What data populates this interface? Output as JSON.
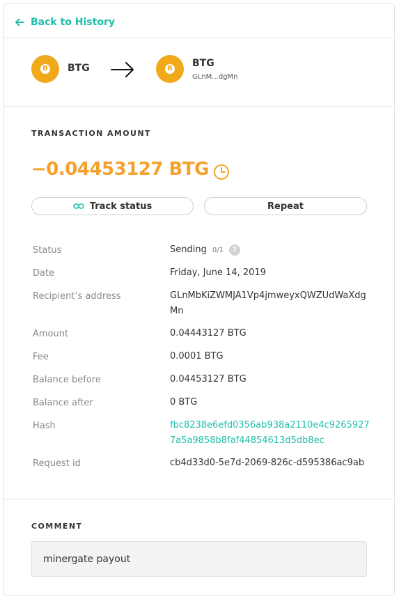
{
  "header": {
    "back_label": "Back to History"
  },
  "transfer": {
    "from": {
      "currency": "BTG",
      "icon": "btg-coin-icon"
    },
    "to": {
      "currency": "BTG",
      "address_short": "GLnM...dgMn",
      "icon": "btg-coin-icon"
    }
  },
  "transaction": {
    "section_title": "TRANSACTION AMOUNT",
    "amount": "−0.04453127 BTG",
    "status_icon": "clock-icon",
    "amount_color": "#f4a12e"
  },
  "actions": {
    "track_label": "Track status",
    "repeat_label": "Repeat"
  },
  "details": {
    "status": {
      "label": "Status",
      "value": "Sending",
      "counter": "0/1"
    },
    "date": {
      "label": "Date",
      "value": "Friday, June 14, 2019"
    },
    "recipient": {
      "label": "Recipient’s address",
      "value": "GLnMbKiZWMJA1Vp4jmweyxQWZUdWaXdgMn"
    },
    "amount": {
      "label": "Amount",
      "value": "0.04443127 BTG"
    },
    "fee": {
      "label": "Fee",
      "value": "0.0001 BTG"
    },
    "balance_before": {
      "label": "Balance before",
      "value": "0.04453127 BTG"
    },
    "balance_after": {
      "label": "Balance after",
      "value": "0 BTG"
    },
    "hash": {
      "label": "Hash",
      "value": "fbc8238e6efd0356ab938a2110e4c92659277a5a9858b8faf44854613d5db8ec"
    },
    "request_id": {
      "label": "Request id",
      "value": "cb4d33d0-5e7d-2069-826c-d595386ac9ab"
    }
  },
  "comment": {
    "section_title": "COMMENT",
    "text": "minergate payout"
  },
  "colors": {
    "accent": "#1fbfa9",
    "coin": "#f0a91b",
    "amount": "#f4a12e"
  }
}
